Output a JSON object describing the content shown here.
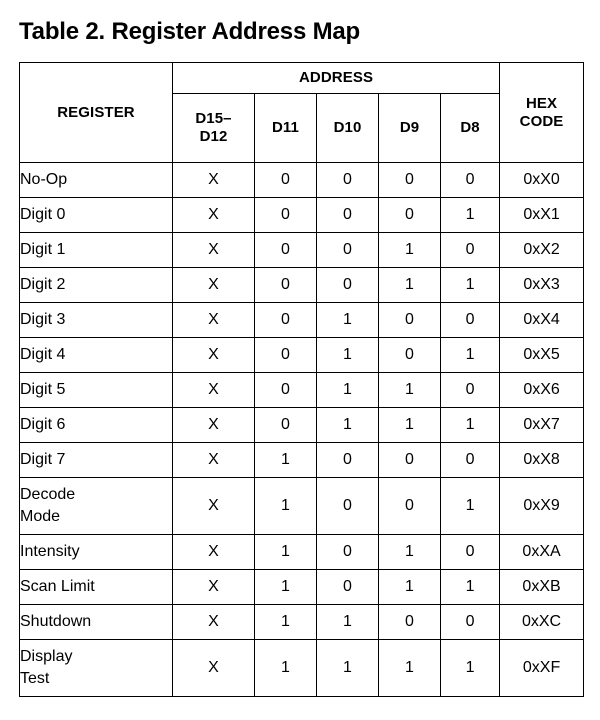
{
  "title": "Table 2. Register Address Map",
  "table": {
    "group_headers": {
      "register": "REGISTER",
      "address": "ADDRESS",
      "hex_code": "HEX\nCODE"
    },
    "columns": [
      {
        "key": "register",
        "label": "REGISTER"
      },
      {
        "key": "d15_d12",
        "label": "D15–D12"
      },
      {
        "key": "d11",
        "label": "D11"
      },
      {
        "key": "d10",
        "label": "D10"
      },
      {
        "key": "d9",
        "label": "D9"
      },
      {
        "key": "d8",
        "label": "D8"
      },
      {
        "key": "hex",
        "label": "HEX CODE"
      }
    ],
    "header_labels": {
      "register": "REGISTER",
      "address": "ADDRESS",
      "d15_d12_line1": "D15–",
      "d15_d12_line2": "D12",
      "d11": "D11",
      "d10": "D10",
      "d9": "D9",
      "d8": "D8",
      "hex_line1": "HEX",
      "hex_line2": "CODE"
    },
    "rows": [
      {
        "register": "No-Op",
        "lines": [
          "No-Op"
        ],
        "d15_d12": "X",
        "d11": "0",
        "d10": "0",
        "d9": "0",
        "d8": "0",
        "hex": "0xX0",
        "tall": false
      },
      {
        "register": "Digit 0",
        "lines": [
          "Digit 0"
        ],
        "d15_d12": "X",
        "d11": "0",
        "d10": "0",
        "d9": "0",
        "d8": "1",
        "hex": "0xX1",
        "tall": false
      },
      {
        "register": "Digit 1",
        "lines": [
          "Digit 1"
        ],
        "d15_d12": "X",
        "d11": "0",
        "d10": "0",
        "d9": "1",
        "d8": "0",
        "hex": "0xX2",
        "tall": false
      },
      {
        "register": "Digit 2",
        "lines": [
          "Digit 2"
        ],
        "d15_d12": "X",
        "d11": "0",
        "d10": "0",
        "d9": "1",
        "d8": "1",
        "hex": "0xX3",
        "tall": false
      },
      {
        "register": "Digit 3",
        "lines": [
          "Digit 3"
        ],
        "d15_d12": "X",
        "d11": "0",
        "d10": "1",
        "d9": "0",
        "d8": "0",
        "hex": "0xX4",
        "tall": false
      },
      {
        "register": "Digit 4",
        "lines": [
          "Digit 4"
        ],
        "d15_d12": "X",
        "d11": "0",
        "d10": "1",
        "d9": "0",
        "d8": "1",
        "hex": "0xX5",
        "tall": false
      },
      {
        "register": "Digit 5",
        "lines": [
          "Digit 5"
        ],
        "d15_d12": "X",
        "d11": "0",
        "d10": "1",
        "d9": "1",
        "d8": "0",
        "hex": "0xX6",
        "tall": false
      },
      {
        "register": "Digit 6",
        "lines": [
          "Digit 6"
        ],
        "d15_d12": "X",
        "d11": "0",
        "d10": "1",
        "d9": "1",
        "d8": "1",
        "hex": "0xX7",
        "tall": false
      },
      {
        "register": "Digit 7",
        "lines": [
          "Digit 7"
        ],
        "d15_d12": "X",
        "d11": "1",
        "d10": "0",
        "d9": "0",
        "d8": "0",
        "hex": "0xX8",
        "tall": false
      },
      {
        "register": "Decode Mode",
        "lines": [
          "Decode",
          "Mode"
        ],
        "d15_d12": "X",
        "d11": "1",
        "d10": "0",
        "d9": "0",
        "d8": "1",
        "hex": "0xX9",
        "tall": true
      },
      {
        "register": "Intensity",
        "lines": [
          "Intensity"
        ],
        "d15_d12": "X",
        "d11": "1",
        "d10": "0",
        "d9": "1",
        "d8": "0",
        "hex": "0xXA",
        "tall": false
      },
      {
        "register": "Scan Limit",
        "lines": [
          "Scan Limit"
        ],
        "d15_d12": "X",
        "d11": "1",
        "d10": "0",
        "d9": "1",
        "d8": "1",
        "hex": "0xXB",
        "tall": false
      },
      {
        "register": "Shutdown",
        "lines": [
          "Shutdown"
        ],
        "d15_d12": "X",
        "d11": "1",
        "d10": "1",
        "d9": "0",
        "d8": "0",
        "hex": "0xXC",
        "tall": false
      },
      {
        "register": "Display Test",
        "lines": [
          "Display",
          "Test"
        ],
        "d15_d12": "X",
        "d11": "1",
        "d10": "1",
        "d9": "1",
        "d8": "1",
        "hex": "0xXF",
        "tall": true
      }
    ]
  },
  "colors": {
    "border": "#000000",
    "text": "#000000",
    "background": "#ffffff"
  }
}
